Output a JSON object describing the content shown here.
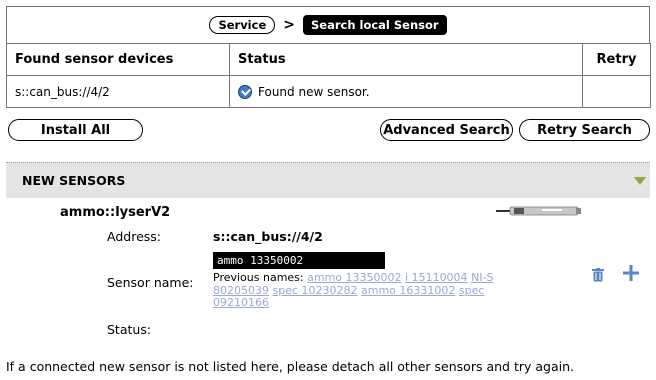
{
  "breadcrumb": {
    "service": "Service",
    "separator": ">",
    "current": "Search local Sensor"
  },
  "table": {
    "headers": [
      "Found sensor devices",
      "Status",
      "Retry"
    ],
    "rows": [
      {
        "device": "s::can_bus://4/2",
        "status": "Found new sensor.",
        "retry": ""
      }
    ]
  },
  "buttons": {
    "install_all": "Install All",
    "advanced_search": "Advanced Search",
    "retry_search": "Retry Search"
  },
  "section": {
    "title": "NEW SENSORS"
  },
  "sensor": {
    "title": "ammo::lyserV2",
    "address_label": "Address:",
    "address_value": "s::can_bus://4/2",
    "name_label": "Sensor name:",
    "name_value": "ammo 13350002",
    "previous_names_label": "Previous names:",
    "previous_names": [
      "ammo 13350002",
      "i 15110004",
      "NI-S 80205039",
      "spec 10230282",
      "ammo 16331002",
      "spec 09210166"
    ],
    "status_label": "Status:"
  },
  "footer": "If a connected new sensor is not listed here, please detach all other sensors and try again.",
  "colors": {
    "accent_link": "#9aa8d6",
    "icon_blue": "#3a7bd5",
    "arrow_green": "#8cae3c",
    "section_bg": "#e4e4e4"
  }
}
